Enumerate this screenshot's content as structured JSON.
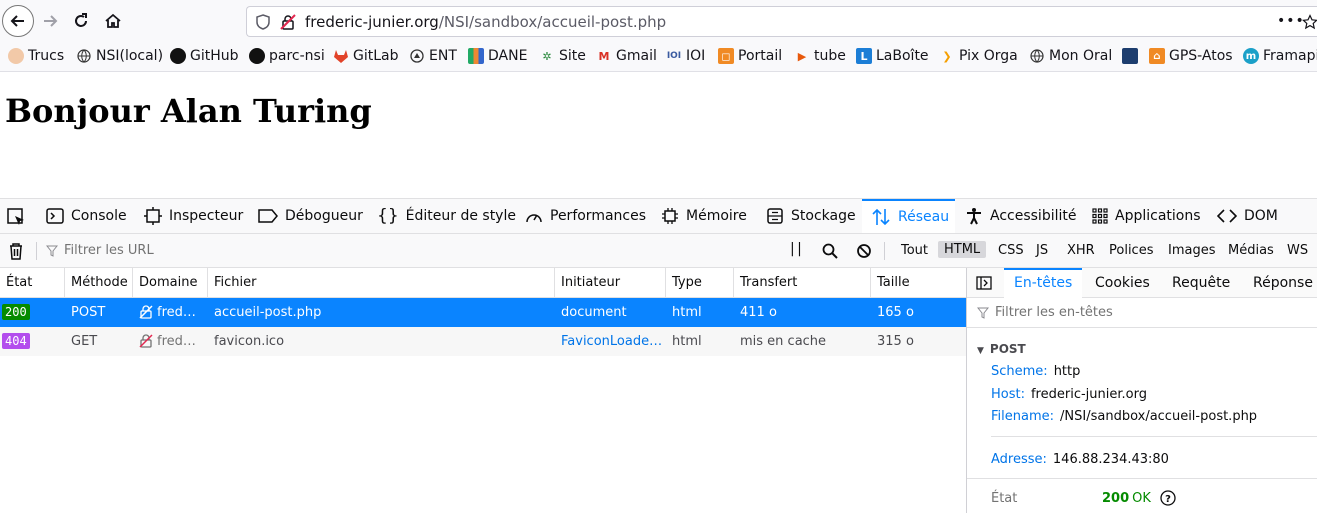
{
  "browser": {
    "url_host": "frederic-junier.org",
    "url_path": "/NSI/sandbox/accueil-post.php",
    "menu_dots": "•••"
  },
  "bookmarks": [
    {
      "label": "Trucs",
      "icon": "person-icon"
    },
    {
      "label": "NSI(local)",
      "icon": "globe-icon"
    },
    {
      "label": "GitHub",
      "icon": "github-icon"
    },
    {
      "label": "parc-nsi",
      "icon": "github-icon"
    },
    {
      "label": "GitLab",
      "icon": "gitlab-icon"
    },
    {
      "label": "ENT",
      "icon": "ent-icon"
    },
    {
      "label": "DANE",
      "icon": "dane-icon"
    },
    {
      "label": "Site",
      "icon": "site-icon"
    },
    {
      "label": "Gmail",
      "icon": "gmail-icon"
    },
    {
      "label": "IOI",
      "icon": "ioi-icon"
    },
    {
      "label": "Portail",
      "icon": "portail-icon"
    },
    {
      "label": "tube",
      "icon": "tube-icon"
    },
    {
      "label": "LaBoîte",
      "icon": "laboite-icon"
    },
    {
      "label": "Pix Orga",
      "icon": "pix-icon"
    },
    {
      "label": "Mon Oral",
      "icon": "globe-icon"
    },
    {
      "label": "",
      "icon": "book-icon"
    },
    {
      "label": "GPS-Atos",
      "icon": "gps-icon"
    },
    {
      "label": "Framapi",
      "icon": "frama-icon"
    }
  ],
  "page": {
    "heading": "Bonjour Alan Turing"
  },
  "devtools": {
    "tabs": [
      "Console",
      "Inspecteur",
      "Débogueur",
      "Éditeur de style",
      "Performances",
      "Mémoire",
      "Stockage",
      "Réseau",
      "Accessibilité",
      "Applications",
      "DOM"
    ],
    "filter_placeholder": "Filtrer les URL",
    "pause_label": "| |",
    "type_filters": [
      "Tout",
      "HTML",
      "CSS",
      "JS",
      "XHR",
      "Polices",
      "Images",
      "Médias",
      "WS"
    ],
    "columns": [
      "État",
      "Méthode",
      "Domaine",
      "Fichier",
      "Initiateur",
      "Type",
      "Transfert",
      "Taille"
    ],
    "requests": [
      {
        "status": "200",
        "method": "POST",
        "domain": "fred…",
        "file": "accueil-post.php",
        "initiator": "document",
        "type": "html",
        "transfer": "411 o",
        "size": "165 o"
      },
      {
        "status": "404",
        "method": "GET",
        "domain": "fred…",
        "file": "favicon.ico",
        "initiator": "FaviconLoader…",
        "type": "html",
        "transfer": "mis en cache",
        "size": "315 o"
      }
    ],
    "colors": {
      "accent": "#0a84ff",
      "status_ok": "#058b00",
      "status_404": "#b34ded"
    }
  },
  "sidepanel": {
    "tabs": [
      "En-têtes",
      "Cookies",
      "Requête",
      "Réponse"
    ],
    "filter_placeholder": "Filtrer les en-têtes",
    "section": "POST",
    "scheme_key": "Scheme:",
    "scheme_val": "http",
    "host_key": "Host:",
    "host_val": "frederic-junier.org",
    "filename_key": "Filename:",
    "filename_val": "/NSI/sandbox/accueil-post.php",
    "address_key": "Adresse:",
    "address_val": "146.88.234.43:80",
    "state_key": "État",
    "state_code": "200",
    "state_text": "OK"
  }
}
